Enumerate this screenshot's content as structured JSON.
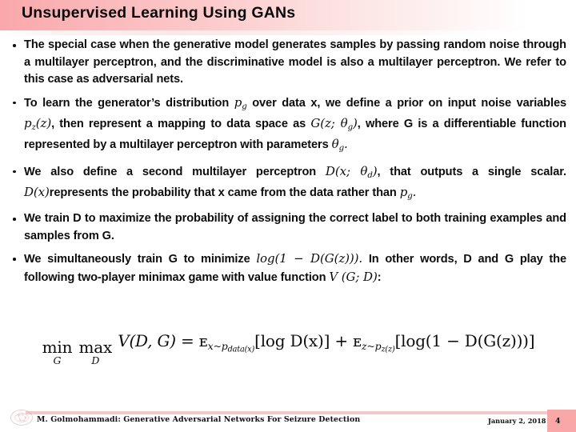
{
  "slide": {
    "title": "Unsupervised Learning Using GANs",
    "accent_pink": "#f9a8ab",
    "page_badge_color": "#f9a8a8",
    "rule_color": "#f3c9ca"
  },
  "bullets": [
    {
      "id": "bullet-1",
      "text": "The special case when the generative model generates samples by passing random noise through a multilayer perceptron, and the discriminative model is also a multilayer perceptron. We refer to this case as adversarial nets."
    },
    {
      "id": "bullet-2",
      "segments": [
        {
          "type": "text",
          "value": "To learn the generator’s distribution "
        },
        {
          "type": "math",
          "value": "p",
          "sub": "g"
        },
        {
          "type": "text",
          "value": " over data x, we define a prior on input noise variables "
        },
        {
          "type": "math",
          "value": "p",
          "sub": "z",
          "tail": "(z)"
        },
        {
          "type": "text",
          "value": ", then represent a mapping to data space as "
        },
        {
          "type": "math",
          "value": "G(z; θ",
          "sub": "g",
          "tail": ")"
        },
        {
          "type": "text",
          "value": ", where G is a differentiable function represented by a multilayer perceptron with parameters "
        },
        {
          "type": "math",
          "value": "θ",
          "sub": "g",
          "tail": "."
        }
      ]
    },
    {
      "id": "bullet-3",
      "segments": [
        {
          "type": "text",
          "value": "We also define a second multilayer perceptron "
        },
        {
          "type": "math",
          "value": "D(x; θ",
          "sub": "d",
          "tail": ")"
        },
        {
          "type": "text",
          "value": ", that outputs a single scalar. "
        },
        {
          "type": "math",
          "value": "D(x)"
        },
        {
          "type": "text",
          "value": "represents the probability that x came from the data rather than "
        },
        {
          "type": "math",
          "value": "p",
          "sub": "g",
          "tail": "."
        }
      ]
    },
    {
      "id": "bullet-4",
      "text": "We train D to maximize the probability of assigning the correct label to both training examples and samples from G."
    },
    {
      "id": "bullet-5",
      "segments": [
        {
          "type": "text",
          "value": "We simultaneously train G to minimize "
        },
        {
          "type": "math",
          "value": "log(1 − D(G(z)))."
        },
        {
          "type": "text",
          "value": " In other words, D and G play the following two-player minimax game with value function "
        },
        {
          "type": "math",
          "value": "V (G; D)"
        },
        {
          "type": "text",
          "value": ":"
        }
      ]
    }
  ],
  "equation": {
    "label": "gan-minimax-objective",
    "plain": "min_G max_D V(D, G) = E_{x~p_data(x)}[log D(x)] + E_{z~p_z(z)}[log(1 - D(G(z)))]",
    "min_op": "min",
    "min_sub": "G",
    "max_op": "max",
    "max_sub": "D",
    "value_function": "V(D, G)",
    "equals": "=",
    "expectation_symbol": "ᴇ",
    "term1_sub": "x~p",
    "term1_sub_small": "data(x)",
    "term1_body": "[log D(x)]",
    "plus": "+",
    "term2_sub": "z~p",
    "term2_sub_small": "z(z)",
    "term2_body": "[log(1 − D(G(z)))]"
  },
  "footer": {
    "credit": "M. Golmohammadi: Generative Adversarial Networks For Seizure Detection",
    "date": "January 2, 2018",
    "page_number": "4"
  }
}
